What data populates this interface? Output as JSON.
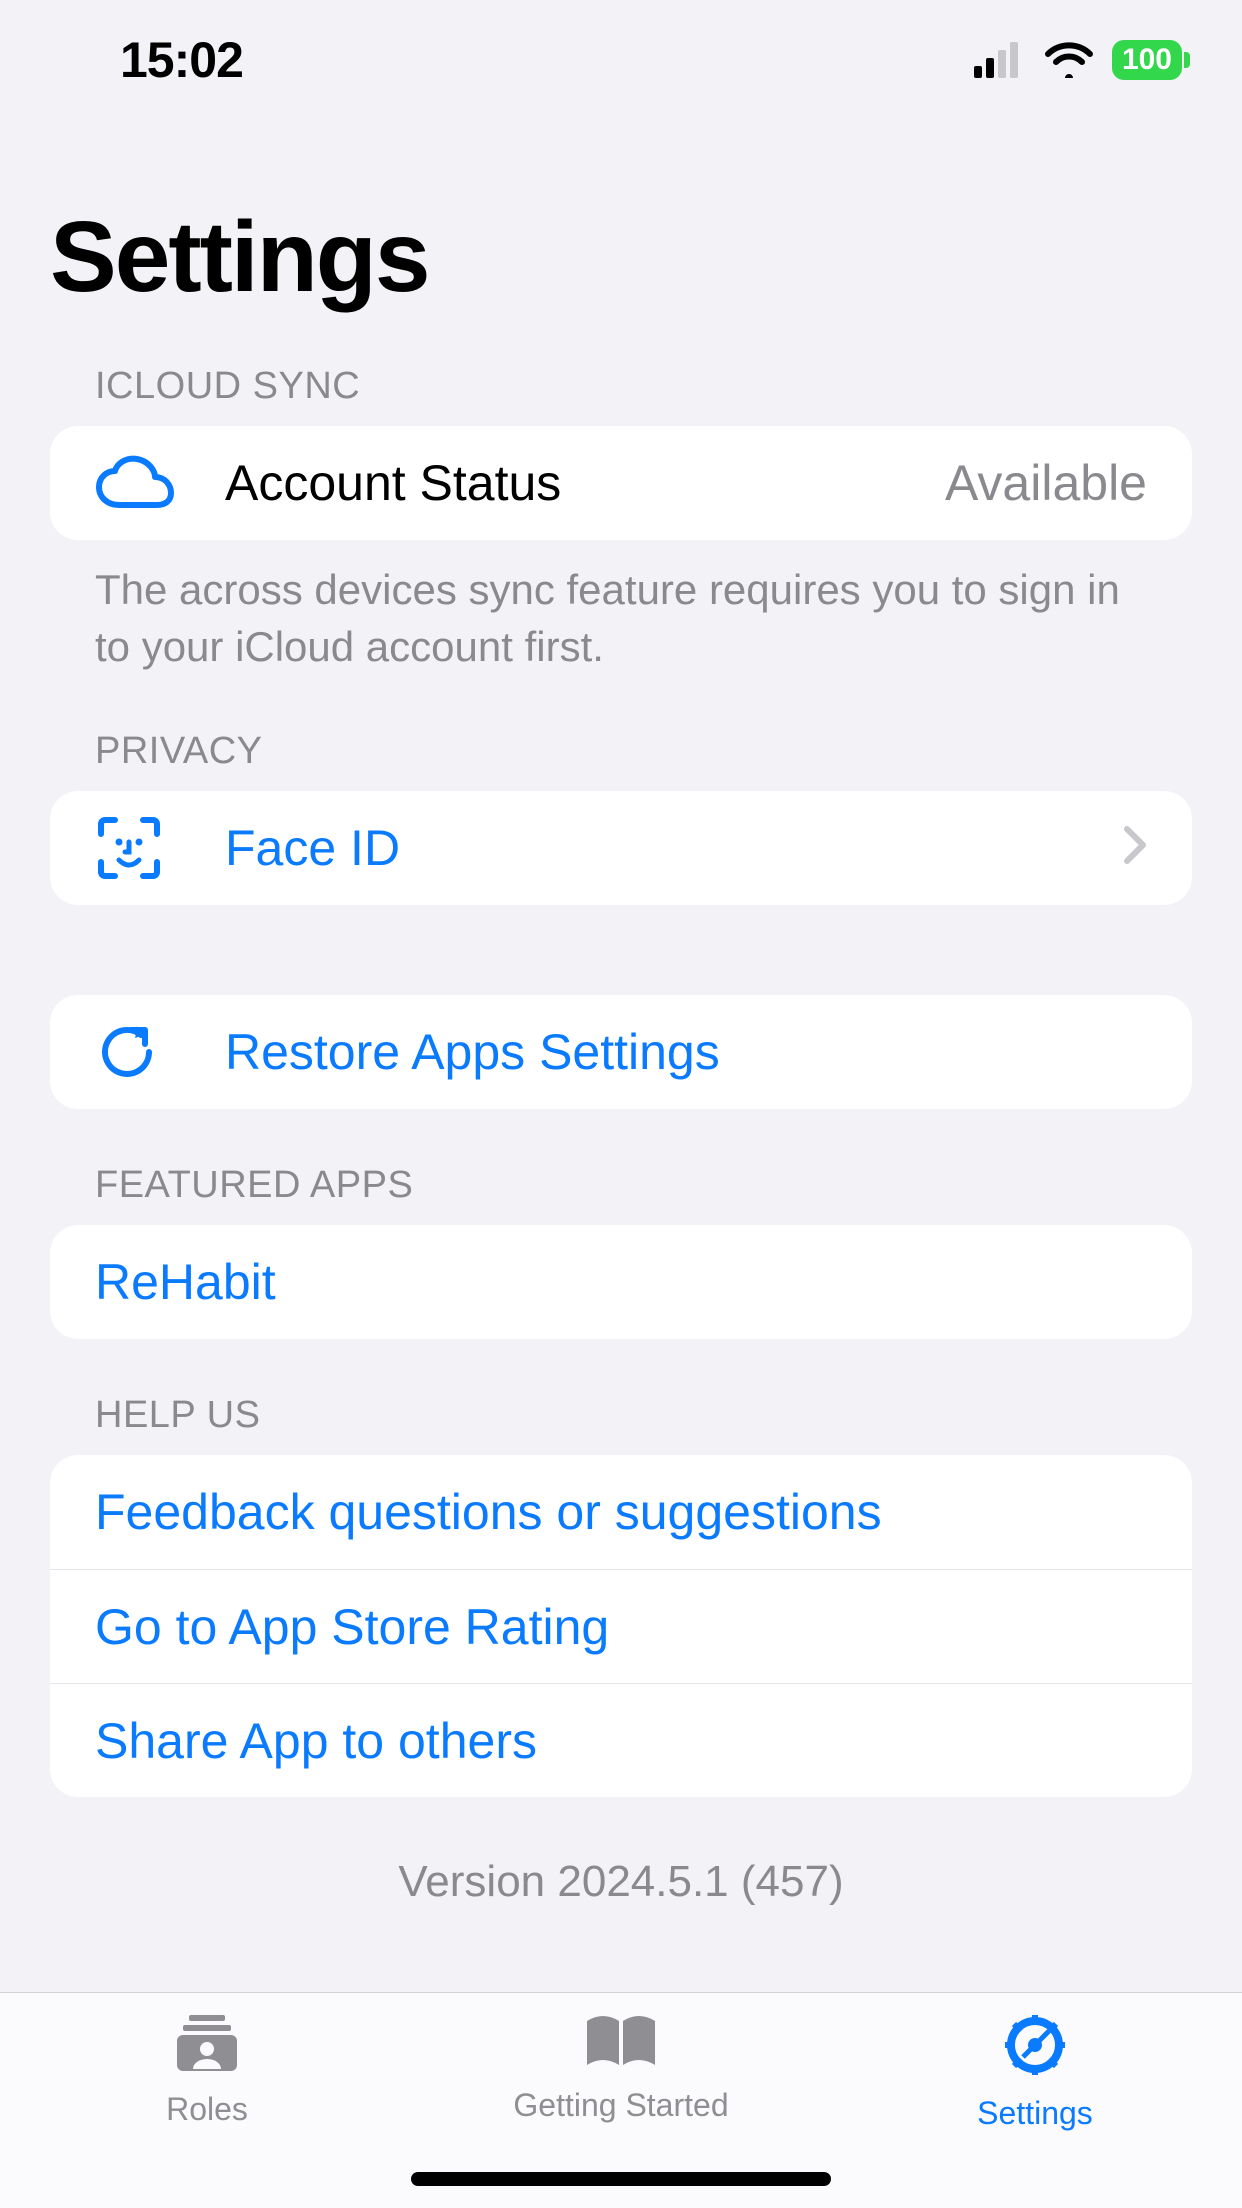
{
  "status": {
    "time": "15:02",
    "battery": "100"
  },
  "title": "Settings",
  "sections": {
    "icloud": {
      "header": "ICLOUD SYNC",
      "account_label": "Account Status",
      "account_value": "Available",
      "footer": "The across devices sync feature requires you to sign in to your iCloud account first."
    },
    "privacy": {
      "header": "PRIVACY",
      "faceid_label": "Face ID"
    },
    "restore": {
      "label": "Restore Apps Settings"
    },
    "featured": {
      "header": "FEATURED APPS",
      "rehabit_label": "ReHabit"
    },
    "helpus": {
      "header": "HELP US",
      "feedback_label": "Feedback questions or suggestions",
      "rate_label": "Go to App Store Rating",
      "share_label": "Share App to others"
    }
  },
  "version": "Version 2024.5.1 (457)",
  "tabs": {
    "roles": "Roles",
    "getting_started": "Getting Started",
    "settings": "Settings"
  }
}
